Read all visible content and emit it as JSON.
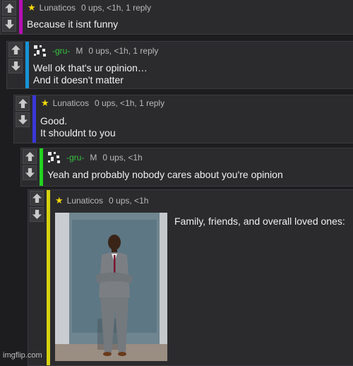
{
  "comments": [
    {
      "user": "Lunaticos",
      "meta": "0 ups, <1h, 1 reply",
      "lines": [
        "Because it isnt funny"
      ]
    },
    {
      "user": "-gru-",
      "badge": "M",
      "meta": "0 ups, <1h, 1 reply",
      "lines": [
        "Well ok that's ur opinion…",
        "And it doesn't matter"
      ]
    },
    {
      "user": "Lunaticos",
      "meta": "0 ups, <1h, 1 reply",
      "lines": [
        "Good.",
        "It shouldnt to you"
      ]
    },
    {
      "user": "-gru-",
      "badge": "M",
      "meta": "0 ups, <1h",
      "lines": [
        "Yeah and probably nobody cares about you're opinion"
      ]
    },
    {
      "user": "Lunaticos",
      "meta": "0 ups, <1h",
      "caption": "Family, friends, and overall loved ones:"
    }
  ],
  "watermark": "imgflip.com",
  "colors": {
    "c1": "#b50eb5",
    "c2": "#1793d6",
    "c3": "#3a37d6",
    "c4": "#23d21f",
    "c5": "#d6d20f"
  },
  "icons": [
    "upvote-arrow-icon",
    "downvote-arrow-icon",
    "star-icon",
    "gru-avatar-icon"
  ]
}
